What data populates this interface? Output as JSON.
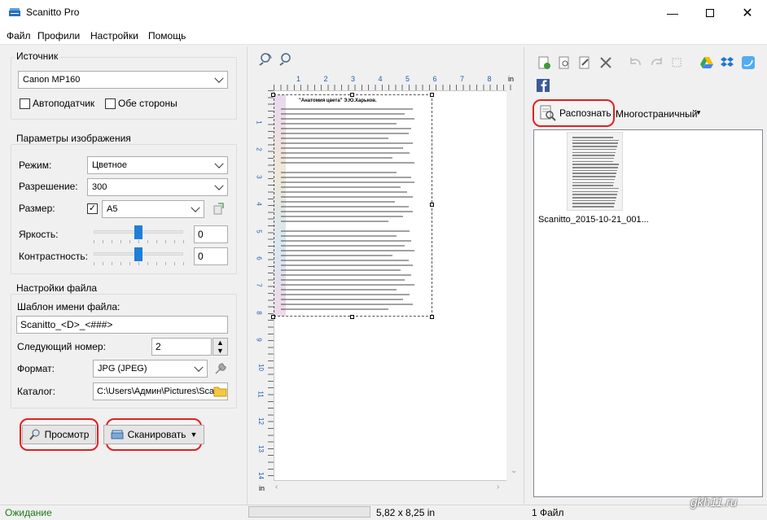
{
  "window": {
    "title": "Scanitto Pro"
  },
  "menu": [
    "Файл",
    "Профили",
    "Настройки",
    "Помощь"
  ],
  "source": {
    "legend": "Источник",
    "device": "Canon MP160",
    "adf_label": "Автоподатчик",
    "duplex_label": "Обе стороны"
  },
  "image_params": {
    "legend": "Параметры изображения",
    "mode_label": "Режим:",
    "mode_value": "Цветное",
    "resolution_label": "Разрешение:",
    "resolution_value": "300",
    "size_label": "Размер:",
    "size_value": "A5",
    "brightness_label": "Яркость:",
    "brightness_value": "0",
    "contrast_label": "Контрастность:",
    "contrast_value": "0"
  },
  "file_settings": {
    "legend": "Настройки файла",
    "template_label": "Шаблон имени файла:",
    "template_value": "Scanitto_<D>_<###>",
    "next_number_label": "Следующий номер:",
    "next_number_value": "2",
    "format_label": "Формат:",
    "format_value": "JPG (JPEG)",
    "folder_label": "Каталог:",
    "folder_value": "C:\\Users\\Админ\\Pictures\\Scan"
  },
  "buttons": {
    "preview": "Просмотр",
    "scan": "Сканировать"
  },
  "preview": {
    "unit": "in",
    "ruler_top": [
      "1",
      "2",
      "3",
      "4",
      "5",
      "6",
      "7",
      "8"
    ],
    "ruler_left": [
      "1",
      "2",
      "3",
      "4",
      "5",
      "6",
      "7",
      "8",
      "9",
      "10",
      "11",
      "12",
      "13",
      "14"
    ],
    "doc_heading": "\"Анатомия цвета\" Э.Ю.Харьков."
  },
  "right": {
    "recognize_label": "Распознать",
    "multipage_label": "Многостраничный",
    "thumbnail_caption": "Scanitto_2015-10-21_001..."
  },
  "status": {
    "state": "Ожидание",
    "dimensions": "5,82 x 8,25 in",
    "file_count": "1 Файл"
  },
  "watermark": "gkh11.ru",
  "colors": {
    "highlight_red": "#e02020",
    "status_green": "#1a7a1a",
    "slider_blue": "#1e7fd8"
  }
}
